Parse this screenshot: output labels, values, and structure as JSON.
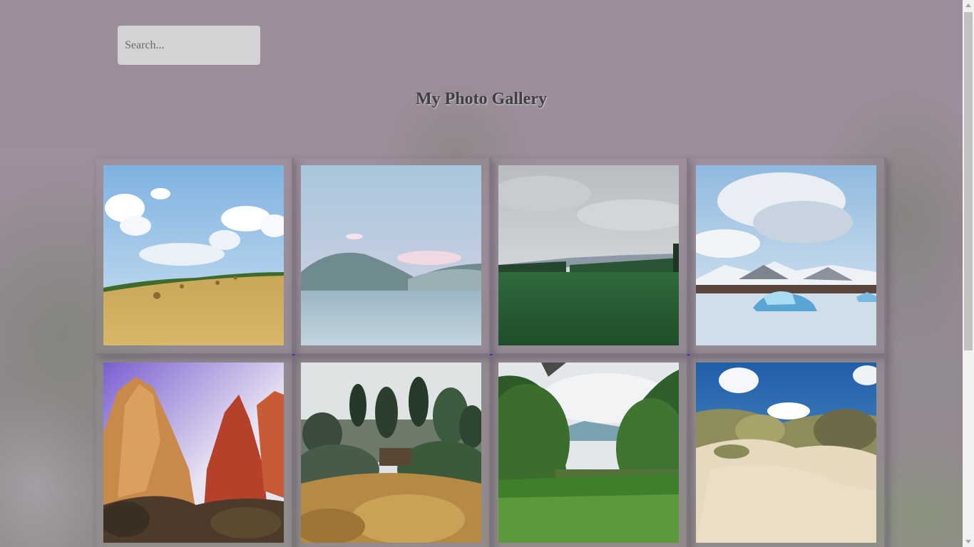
{
  "search": {
    "placeholder": "Search...",
    "value": ""
  },
  "page": {
    "title": "My Photo Gallery"
  },
  "gallery": {
    "photos": [
      {
        "subject": "hay field with bales under cloudy sky"
      },
      {
        "subject": "lake with mountains under pale sky"
      },
      {
        "subject": "green forest plain under overcast sky"
      },
      {
        "subject": "glacier lagoon with icebergs and snowy mountains"
      },
      {
        "subject": "red rock canyon peaks"
      },
      {
        "subject": "garden with trees and shrubs"
      },
      {
        "subject": "green valley with dense trees"
      },
      {
        "subject": "sand dunes with grass under blue sky"
      }
    ]
  },
  "colors": {
    "background": "#9a8c98",
    "search_bg": "#d3d3d5",
    "title_text": "#3f3f45",
    "scrollbar_track": "#f1f1f1",
    "scrollbar_thumb": "#c1c1c1"
  }
}
